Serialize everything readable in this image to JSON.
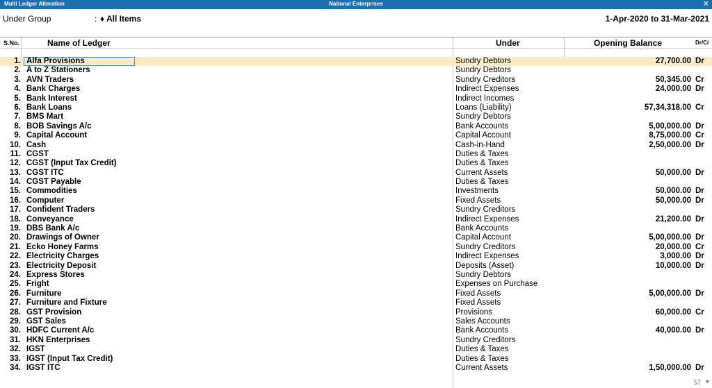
{
  "window": {
    "title_left": "Multi Ledger  Alteration",
    "title_center": "National Enterprises",
    "close_icon": "✕"
  },
  "filter": {
    "label": "Under Group",
    "colon": ":",
    "value": "♦ All Items",
    "period": "1-Apr-2020 to 31-Mar-2021"
  },
  "columns": {
    "sno": "S.No.",
    "name": "Name of Ledger",
    "under": "Under",
    "balance": "Opening Balance",
    "drcr": "Dr/Cr"
  },
  "rows": [
    {
      "sno": "1.",
      "name": "Alfa Provisions",
      "under": "Sundry Debtors",
      "balance": "27,700.00",
      "drcr": "Dr"
    },
    {
      "sno": "2.",
      "name": "A to Z Stationers",
      "under": "Sundry Debtors",
      "balance": "",
      "drcr": ""
    },
    {
      "sno": "3.",
      "name": "AVN Traders",
      "under": "Sundry Creditors",
      "balance": "50,345.00",
      "drcr": "Cr"
    },
    {
      "sno": "4.",
      "name": "Bank Charges",
      "under": "Indirect Expenses",
      "balance": "24,000.00",
      "drcr": "Dr"
    },
    {
      "sno": "5.",
      "name": "Bank Interest",
      "under": "Indirect Incomes",
      "balance": "",
      "drcr": ""
    },
    {
      "sno": "6.",
      "name": "Bank Loans",
      "under": "Loans (Liability)",
      "balance": "57,34,318.00",
      "drcr": "Cr"
    },
    {
      "sno": "7.",
      "name": "BMS Mart",
      "under": "Sundry Debtors",
      "balance": "",
      "drcr": ""
    },
    {
      "sno": "8.",
      "name": "BOB Savings A/c",
      "under": "Bank Accounts",
      "balance": "5,00,000.00",
      "drcr": "Dr"
    },
    {
      "sno": "9.",
      "name": "Capital Account",
      "under": "Capital Account",
      "balance": "8,75,000.00",
      "drcr": "Cr"
    },
    {
      "sno": "10.",
      "name": "Cash",
      "under": "Cash-in-Hand",
      "balance": "2,50,000.00",
      "drcr": "Dr"
    },
    {
      "sno": "11.",
      "name": "CGST",
      "under": "Duties & Taxes",
      "balance": "",
      "drcr": ""
    },
    {
      "sno": "12.",
      "name": "CGST (Input Tax Credit)",
      "under": "Duties & Taxes",
      "balance": "",
      "drcr": ""
    },
    {
      "sno": "13.",
      "name": "CGST ITC",
      "under": "Current Assets",
      "balance": "50,000.00",
      "drcr": "Dr"
    },
    {
      "sno": "14.",
      "name": "CGST Payable",
      "under": "Duties & Taxes",
      "balance": "",
      "drcr": ""
    },
    {
      "sno": "15.",
      "name": "Commodities",
      "under": "Investments",
      "balance": "50,000.00",
      "drcr": "Dr"
    },
    {
      "sno": "16.",
      "name": "Computer",
      "under": "Fixed Assets",
      "balance": "50,000.00",
      "drcr": "Dr"
    },
    {
      "sno": "17.",
      "name": "Confident Traders",
      "under": "Sundry Creditors",
      "balance": "",
      "drcr": ""
    },
    {
      "sno": "18.",
      "name": "Conveyance",
      "under": "Indirect Expenses",
      "balance": "21,200.00",
      "drcr": "Dr"
    },
    {
      "sno": "19.",
      "name": "DBS Bank A/c",
      "under": "Bank Accounts",
      "balance": "",
      "drcr": ""
    },
    {
      "sno": "20.",
      "name": "Drawings of Owner",
      "under": "Capital Account",
      "balance": "5,00,000.00",
      "drcr": "Dr"
    },
    {
      "sno": "21.",
      "name": "Ecko Honey Farms",
      "under": "Sundry Creditors",
      "balance": "20,000.00",
      "drcr": "Cr"
    },
    {
      "sno": "22.",
      "name": "Electricity Charges",
      "under": "Indirect Expenses",
      "balance": "3,000.00",
      "drcr": "Dr"
    },
    {
      "sno": "23.",
      "name": "Electricity Deposit",
      "under": "Deposits (Asset)",
      "balance": "10,000.00",
      "drcr": "Dr"
    },
    {
      "sno": "24.",
      "name": "Express Stores",
      "under": "Sundry Debtors",
      "balance": "",
      "drcr": ""
    },
    {
      "sno": "25.",
      "name": "Fright",
      "under": "Expenses on Purchase",
      "balance": "",
      "drcr": ""
    },
    {
      "sno": "26.",
      "name": "Furniture",
      "under": "Fixed Assets",
      "balance": "5,00,000.00",
      "drcr": "Dr"
    },
    {
      "sno": "27.",
      "name": "Furniture and Fixture",
      "under": "Fixed Assets",
      "balance": "",
      "drcr": ""
    },
    {
      "sno": "28.",
      "name": "GST Provision",
      "under": "Provisions",
      "balance": "60,000.00",
      "drcr": "Cr"
    },
    {
      "sno": "29.",
      "name": "GST Sales",
      "under": "Sales Accounts",
      "balance": "",
      "drcr": ""
    },
    {
      "sno": "30.",
      "name": "HDFC Current A/c",
      "under": "Bank Accounts",
      "balance": "40,000.00",
      "drcr": "Dr"
    },
    {
      "sno": "31.",
      "name": "HKN Enterprises",
      "under": "Sundry Creditors",
      "balance": "",
      "drcr": ""
    },
    {
      "sno": "32.",
      "name": "IGST",
      "under": "Duties & Taxes",
      "balance": "",
      "drcr": ""
    },
    {
      "sno": "33.",
      "name": "IGST (Input Tax Credit)",
      "under": "Duties & Taxes",
      "balance": "",
      "drcr": ""
    },
    {
      "sno": "34.",
      "name": "IGST ITC",
      "under": "Current Assets",
      "balance": "1,50,000.00",
      "drcr": "Dr"
    }
  ],
  "footer": {
    "page_count": "57",
    "scroll_down_icon": "▼",
    "scroll_up_icon": "▲"
  },
  "colors": {
    "titlebar": "#1f6fb0",
    "selected_row": "#fdebc6",
    "focus_border": "#4a90c8"
  }
}
